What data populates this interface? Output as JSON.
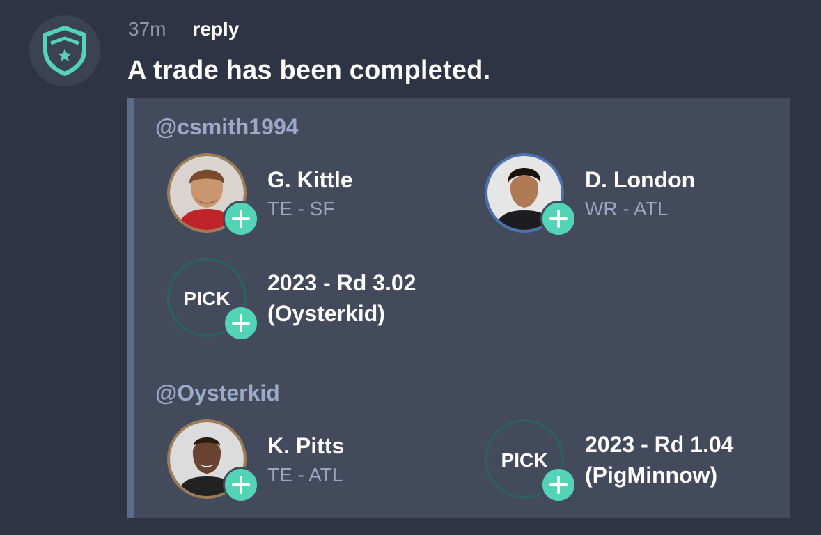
{
  "post": {
    "time": "37m",
    "reply_label": "reply",
    "message": "A trade has been completed."
  },
  "trade": {
    "sides": [
      {
        "user": "@csmith1994",
        "players": [
          {
            "name": "G. Kittle",
            "position": "TE - SF",
            "ring_color": "#9c7c56"
          },
          {
            "name": "D. London",
            "position": "WR - ATL",
            "ring_color": "#4b72b0"
          }
        ],
        "picks": [
          {
            "badge": "PICK",
            "line1": "2023 - Rd 3.02",
            "line2": "(Oysterkid)"
          }
        ]
      },
      {
        "user": "@Oysterkid",
        "players": [
          {
            "name": "K. Pitts",
            "position": "TE - ATL",
            "ring_color": "#9c7c56"
          }
        ],
        "picks": [
          {
            "badge": "PICK",
            "line1": "2023 - Rd 1.04",
            "line2": "(PigMinnow)"
          }
        ]
      }
    ]
  },
  "icons": {
    "bot_avatar": "shield-star-icon",
    "add": "plus-icon"
  },
  "colors": {
    "accent": "#54d4b6",
    "background": "#2e3443",
    "card": "#434a5b"
  }
}
